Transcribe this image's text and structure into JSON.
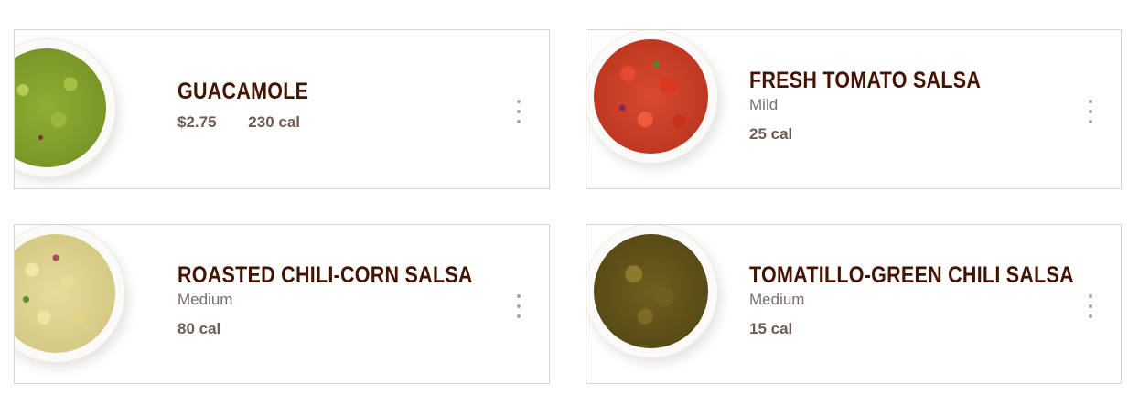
{
  "items": [
    {
      "name": "GUACAMOLE",
      "level": "",
      "price": "$2.75",
      "calories": "230 cal",
      "image": "guacamole-bowl"
    },
    {
      "name": "FRESH TOMATO SALSA",
      "level": "Mild",
      "price": "",
      "calories": "25 cal",
      "image": "tomato-salsa-bowl"
    },
    {
      "name": "ROASTED CHILI-CORN SALSA",
      "level": "Medium",
      "price": "",
      "calories": "80 cal",
      "image": "corn-salsa-bowl"
    },
    {
      "name": "TOMATILLO-GREEN CHILI SALSA",
      "level": "Medium",
      "price": "",
      "calories": "15 cal",
      "image": "tomatillo-salsa-bowl"
    }
  ],
  "colors": {
    "title": "#451400",
    "subtext": "#7a6e68",
    "meta": "#6f5c52",
    "border": "#d8d4d0",
    "more_dots": "#a8a4a0"
  },
  "icons": {
    "more": "vertical-ellipsis-icon"
  }
}
